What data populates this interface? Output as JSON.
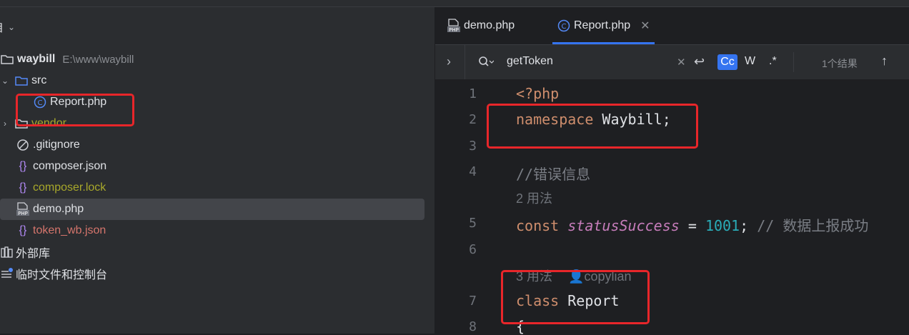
{
  "colors": {
    "accent": "#3574f0",
    "highlight_box": "#e8262a",
    "keyword": "#cf8e6d",
    "comment": "#7a7e85",
    "number": "#2aacb8",
    "field_italic": "#c77dbb",
    "untracked_file": "#d5756c",
    "ignored_file": "#a8a82a"
  },
  "project_panel": {
    "title_fragment": "目",
    "tree": [
      {
        "label": "waybill",
        "path": "E:\\www\\waybill",
        "icon": "folder-icon"
      },
      {
        "label": "src",
        "icon": "folder-icon"
      },
      {
        "label": "Report.php",
        "icon": "php-class-icon"
      },
      {
        "label": "vendor",
        "icon": "folder-icon"
      },
      {
        "label": ".gitignore",
        "icon": "ignore-icon"
      },
      {
        "label": "composer.json",
        "icon": "json-icon"
      },
      {
        "label": "composer.lock",
        "icon": "json-icon"
      },
      {
        "label": "demo.php",
        "icon": "php-file-icon"
      },
      {
        "label": "token_wb.json",
        "icon": "json-icon"
      },
      {
        "label": "外部库",
        "icon": "library-icon"
      },
      {
        "label": "临时文件和控制台",
        "icon": "scratches-icon"
      }
    ]
  },
  "editor": {
    "tabs": [
      {
        "label": "demo.php",
        "icon": "php-file-icon"
      },
      {
        "label": "Report.php",
        "icon": "php-class-icon",
        "active": true
      }
    ],
    "find": {
      "query": "getToken",
      "case_label": "Cc",
      "word_label": "W",
      "regex_label": ".*",
      "result": "1个结果"
    },
    "lines": {
      "l1": "1",
      "l2": "2",
      "l3": "3",
      "l4": "4",
      "l5": "5",
      "l6": "6",
      "l7": "7",
      "l8": "8",
      "php_open": "<?php",
      "ns_kw": "namespace",
      "ns_name": " Waybill;",
      "comment1": "//错误信息",
      "usage1": "2 用法",
      "const_kw": "const",
      "const_name": "statusSuccess",
      "const_eq": " = ",
      "const_val": "1001",
      "const_semi": ";",
      "const_comment": " // 数据上报成功",
      "usage2": "3 用法",
      "author": "copylian",
      "class_kw": "class",
      "class_name": " Report",
      "brace": "{"
    }
  }
}
